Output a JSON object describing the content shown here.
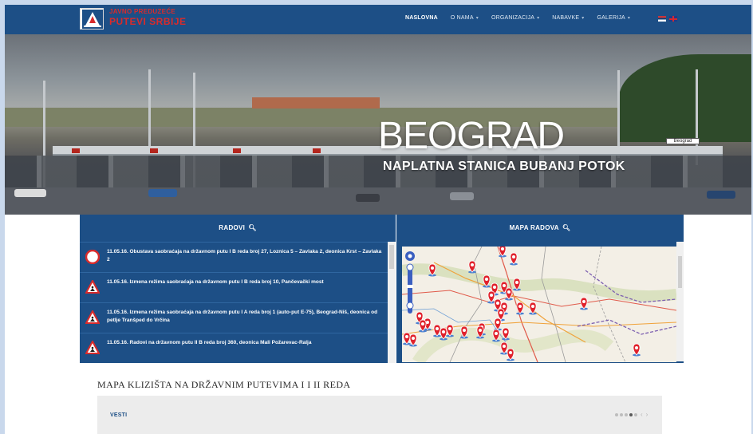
{
  "header": {
    "logo_line1": "JAVNO PREDUZEĆE",
    "logo_line2": "PUTEVI SRBIJE",
    "nav": [
      {
        "label": "NASLOVNA",
        "active": true,
        "has_menu": false
      },
      {
        "label": "O NAMA",
        "active": false,
        "has_menu": true
      },
      {
        "label": "ORGANIZACIJA",
        "active": false,
        "has_menu": true
      },
      {
        "label": "NABAVKE",
        "active": false,
        "has_menu": true
      },
      {
        "label": "GALERIJA",
        "active": false,
        "has_menu": true
      }
    ],
    "languages": [
      "sr",
      "en"
    ]
  },
  "hero": {
    "title": "BEOGRAD",
    "subtitle": "NAPLATNA STANICA BUBANJ POTOK",
    "sign_text": "Beograd"
  },
  "radovi": {
    "heading": "RADOVI",
    "items": [
      {
        "icon": "no-entry-sign-icon",
        "text": "11.05.16. Obustava saobraćaja na državnom putu I B reda broj 27, Loznica 5 – Zavlaka 2, deonica Krst – Zavlaka 2"
      },
      {
        "icon": "roadworks-sign-icon",
        "text": "11.05.16. Izmena režima saobraćaja na državnom putu I B reda broj 10, Pančevački most"
      },
      {
        "icon": "roadworks-sign-icon",
        "text": "11.05.16. Izmena režima saobraćaja na državnom putu I A reda broj 1 (auto-put E-75), Beograd-Niš, deonica od petlje Tranšped do Vrčina"
      },
      {
        "icon": "roadworks-sign-icon",
        "text": "11.05.16. Radovi na državnom putu II B reda broj 360, deonica Mali Požarevac-Ralja"
      }
    ]
  },
  "mapa_radova": {
    "heading": "MAPA RADOVA"
  },
  "landslide": {
    "title": "MAPA KLIZIŠTA NA DRŽAVNIM PUTEVIMA I I II REDA"
  },
  "vesti": {
    "label": "VESTI",
    "pager_count": 5,
    "pager_active": 4
  },
  "colors": {
    "brand_blue": "#1d4f86",
    "accent_red": "#d92b2b",
    "page_bg": "#c9d8ec"
  }
}
